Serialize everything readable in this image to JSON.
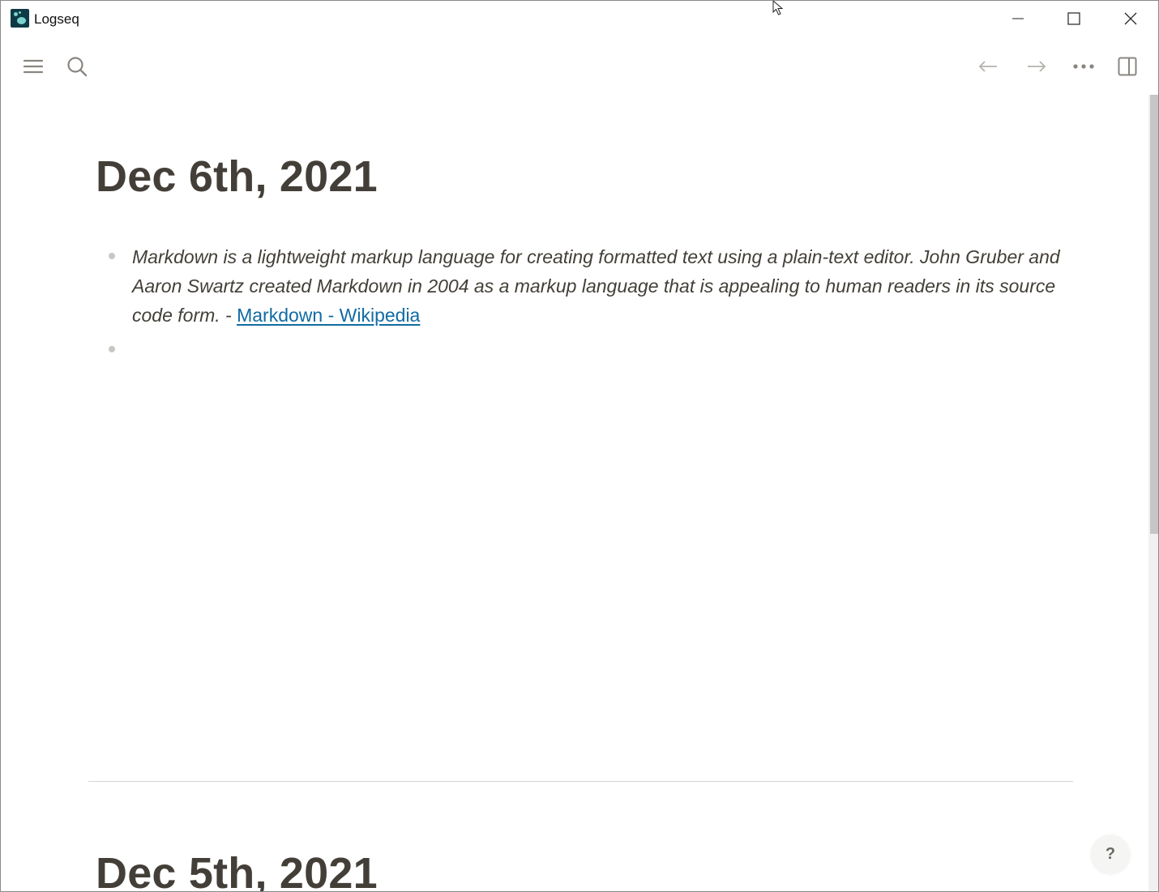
{
  "window": {
    "title": "Logseq",
    "icons": [
      "logseq-logo",
      "minimize-icon",
      "maximize-icon",
      "close-icon"
    ]
  },
  "toolbar": {
    "icons": [
      "menu-icon",
      "search-icon",
      "back-arrow-icon",
      "forward-arrow-icon",
      "more-icon",
      "right-sidebar-icon"
    ]
  },
  "journals": [
    {
      "title": "Dec 6th, 2021",
      "blocks": [
        {
          "text": "Markdown is a lightweight markup language for creating formatted text using a plain-text editor. John Gruber and Aaron Swartz created Markdown in 2004 as a markup language that is appealing to human readers in its source code form. - ",
          "link_text": "Markdown - Wikipedia"
        },
        {
          "text": "",
          "link_text": ""
        }
      ]
    },
    {
      "title": "Dec 5th, 2021",
      "blocks": []
    }
  ],
  "help": {
    "label": "?"
  },
  "colors": {
    "text": "#433f38",
    "link": "#106ba3",
    "bullet": "#c8c7c2",
    "logo_bg": "#0e3a45",
    "logo_accent": "#7ad3cd"
  }
}
